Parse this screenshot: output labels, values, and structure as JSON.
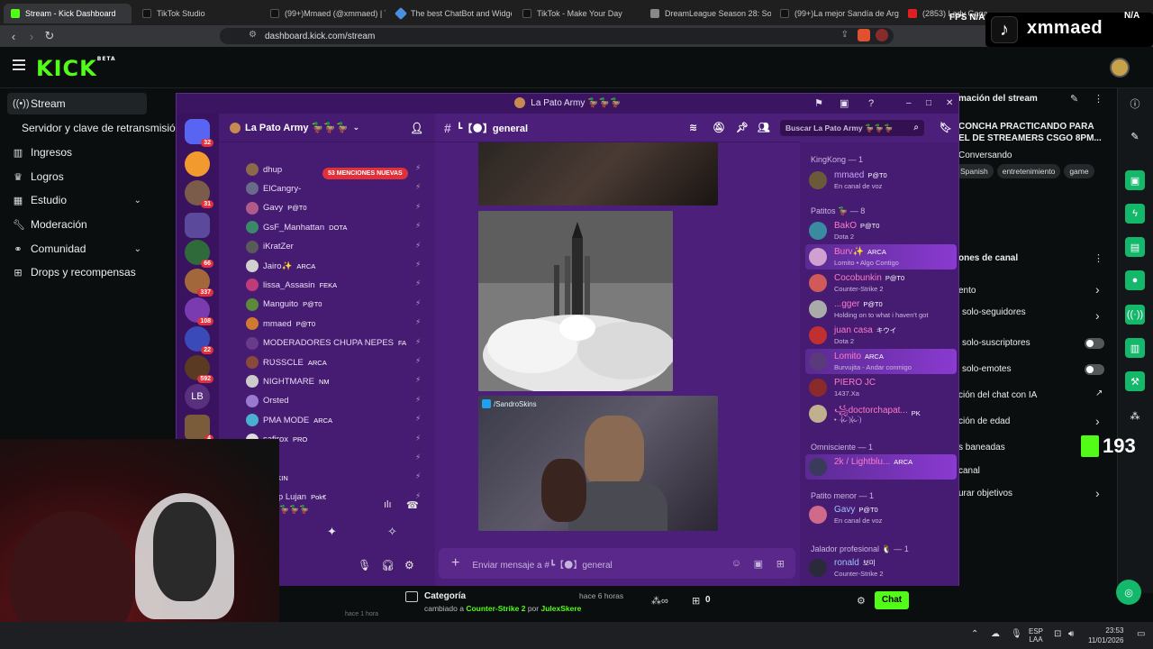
{
  "browser": {
    "tabs": [
      {
        "label": "Stream - Kick Dashboard",
        "color": "#53fc18"
      },
      {
        "label": "TikTok Studio",
        "color": "#111111"
      },
      {
        "label": "(99+)Mmaed (@xmmaed) | TikTok",
        "color": "#111111"
      },
      {
        "label": "The best ChatBot and Widgets",
        "color": "#4a90e2"
      },
      {
        "label": "TikTok - Make Your Day",
        "color": "#111111"
      },
      {
        "label": "DreamLeague Season 28: South...",
        "color": "#888888"
      },
      {
        "label": "(99+)La mejor Sandía de Arg...",
        "color": "#111111"
      },
      {
        "label": "(2853) Lady Gaga, Br...",
        "color": "#e02020"
      }
    ],
    "url": "dashboard.kick.com/stream"
  },
  "overlay": {
    "fps_label": "FPS",
    "fps_value": "N/A",
    "status_value": "N/A",
    "username": "xmmaed"
  },
  "kick": {
    "logo": "KICK",
    "logo_badge": "BETA",
    "nav": [
      {
        "label": "Stream",
        "selected": true,
        "icon": "broadcast-icon"
      },
      {
        "label": "Servidor y clave de retransmisión",
        "selected": false,
        "icon": ""
      },
      {
        "label": "Ingresos",
        "selected": false,
        "icon": "chart-icon"
      },
      {
        "label": "Logros",
        "selected": false,
        "icon": "trophy-icon"
      },
      {
        "label": "Estudio",
        "selected": false,
        "icon": "studio-icon",
        "chevron": true
      },
      {
        "label": "Moderación",
        "selected": false,
        "icon": "wrench-icon"
      },
      {
        "label": "Comunidad",
        "selected": false,
        "icon": "community-icon",
        "chevron": true
      },
      {
        "label": "Drops y recompensas",
        "selected": false,
        "icon": "gift-icon"
      }
    ],
    "right_panel": {
      "section_title": "mación del stream",
      "stream_title": "CONCHA PRACTICANDO PARA EL DE STREAMERS CSGO 8PM...",
      "category": "Conversando",
      "tags": [
        "Spanish",
        "entretenimiento",
        "game"
      ],
      "channel_options_title": "ones de canal",
      "options": [
        {
          "label": "ento",
          "control": "chevron"
        },
        {
          "label": "solo-seguidores",
          "control": "chevron"
        },
        {
          "label": "solo-suscriptores",
          "control": "toggle"
        },
        {
          "label": "solo-emotes",
          "control": "toggle"
        },
        {
          "label": "ción del chat con IA",
          "control": "external"
        },
        {
          "label": "ción de edad",
          "control": "chevron"
        },
        {
          "label": "s baneadas",
          "control": ""
        },
        {
          "label": "canal",
          "control": ""
        },
        {
          "label": "urar objetivos",
          "control": "chevron"
        }
      ]
    },
    "bottom": {
      "event_title": "Categoría",
      "event_time": "hace 6 horas",
      "event_text_prefix": "cambiado a",
      "event_category": "Counter-Strike 2",
      "event_text_mid": "por",
      "event_user": "JulexSkere",
      "event_time2": "hace 1 hora",
      "viewers_count": "0",
      "chat_button": "Chat"
    },
    "follower_count": "193",
    "accent": "#53fc18"
  },
  "discord": {
    "window_title": "La Pato Army 🦆🦆🦆",
    "server_name": "La Pato Army 🦆🦆🦆",
    "channel_name": "┗【🌑】general",
    "search_placeholder": "Buscar La Pato Army 🦆🦆🦆",
    "message_placeholder": "Enviar mensaje a #┗【🌑】general",
    "mentions_badge": "53 MENCIONES NUEVAS",
    "server_badges": [
      "32",
      "31",
      "66",
      "337",
      "108",
      "22",
      "592",
      "4"
    ],
    "server_lb": "LB",
    "voice_members": [
      {
        "name": "dhup",
        "tag": ""
      },
      {
        "name": "ElCangry-",
        "tag": ""
      },
      {
        "name": "Gavy",
        "tag": "P@T0"
      },
      {
        "name": "GsF_Manhattan",
        "tag": "DOTA"
      },
      {
        "name": "iKratZer",
        "tag": ""
      },
      {
        "name": "Jairo✨",
        "tag": "ARCA"
      },
      {
        "name": "lissa_Assasin",
        "tag": "FEKA"
      },
      {
        "name": "Manguito",
        "tag": "P@T0"
      },
      {
        "name": "mmaed",
        "tag": "P@T0"
      },
      {
        "name": "MODERADORES CHUPA NEPES",
        "tag": "FA"
      },
      {
        "name": "ɌƲSSCLE",
        "tag": "ARCA"
      },
      {
        "name": "NIGHTMARE",
        "tag": "NM"
      },
      {
        "name": "Orsted",
        "tag": ""
      },
      {
        "name": "PMA MODE",
        "tag": "ARCA"
      },
      {
        "name": "safirox",
        "tag": "PRO"
      },
      {
        "name": "dow",
        "tag": ""
      },
      {
        "name": "n",
        "tag": "SKIN"
      },
      {
        "name": "eSup Lujan",
        "tag": "Pok€"
      }
    ],
    "voice_status": "y 🦆🦆🦆",
    "image_caption": "/SandroSkins",
    "member_groups": [
      {
        "title": "KingKong — 1",
        "members": [
          {
            "name": "mmaed",
            "tag": "P@T0",
            "status": "En canal de voz",
            "color": "#c9a0ff"
          }
        ]
      },
      {
        "title": "Patitos 🦆 — 8",
        "members": [
          {
            "name": "BakO",
            "tag": "P@T0",
            "status": "Dota 2",
            "color": "#ff7ac8"
          },
          {
            "name": "Burv✨",
            "tag": "ARCA",
            "status": "Lomito • Algo Contigo",
            "color": "#ff7ac8"
          },
          {
            "name": "Cocobunkin",
            "tag": "P@T0",
            "status": "Counter-Strike 2",
            "color": "#ff7ac8"
          },
          {
            "name": "...gger",
            "tag": "P@T0",
            "status": "Holding on to what i haven't got",
            "color": "#ff7ac8"
          },
          {
            "name": "juan casa",
            "tag": "キウイ",
            "status": "Dota 2",
            "color": "#ff7ac8"
          },
          {
            "name": "Lomito",
            "tag": "ARCA",
            "status": "Burvujita - Andar conmigo",
            "color": "#ff7ac8"
          },
          {
            "name": "PIERO JC",
            "tag": "",
            "status": "1437.Xa",
            "color": "#ff7ac8"
          },
          {
            "name": "꧁doctorchapat...",
            "tag": "PK",
            "status": "• ·(̷̀ᴗ·̀)(̷̀ᴗ·̀)",
            "color": "#ff7ac8"
          }
        ]
      },
      {
        "title": "Omnisciente — 1",
        "members": [
          {
            "name": "2k / Lightblu...",
            "tag": "ARCA",
            "status": "",
            "color": "#ff7ac8"
          }
        ]
      },
      {
        "title": "Patito menor — 1",
        "members": [
          {
            "name": "Gavy",
            "tag": "P@T0",
            "status": "En canal de voz",
            "color": "#9ec0ff"
          }
        ]
      },
      {
        "title": "Jalador profesional 🐧 — 1",
        "members": [
          {
            "name": "ronald",
            "tag": "보미",
            "status": "Counter-Strike 2",
            "color": "#9ec0ff"
          }
        ]
      }
    ]
  },
  "taskbar": {
    "lang": "ESP",
    "lang2": "LAA",
    "time": "23:53",
    "date": "11/01/2026"
  }
}
